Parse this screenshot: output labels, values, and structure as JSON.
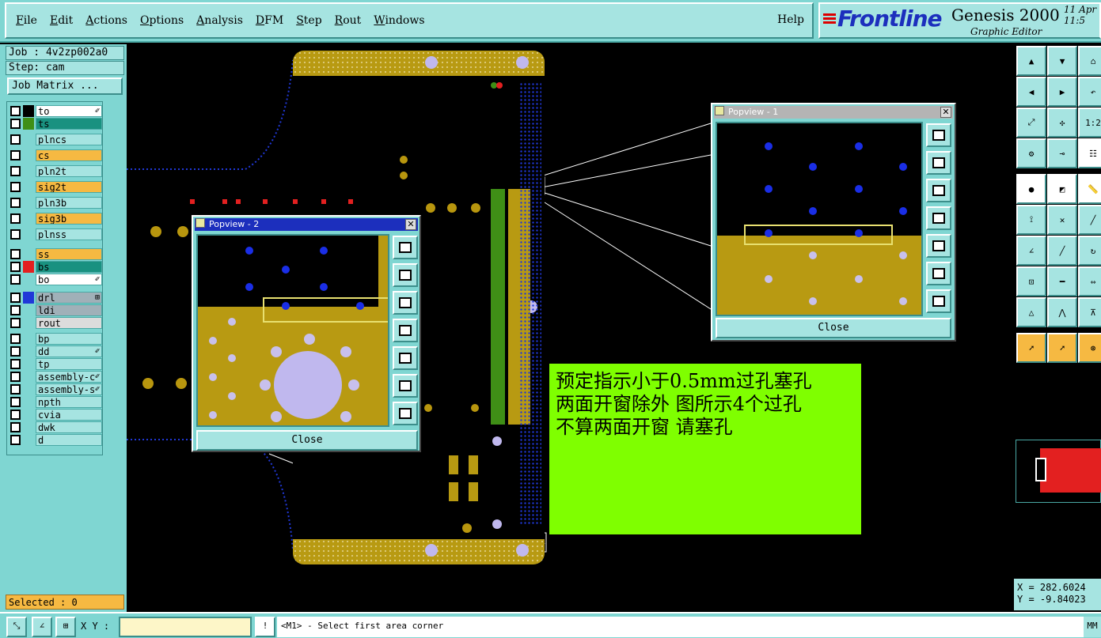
{
  "menu": [
    "File",
    "Edit",
    "Actions",
    "Options",
    "Analysis",
    "DFM",
    "Step",
    "Rout",
    "Windows"
  ],
  "help": "Help",
  "brand": {
    "logo": "Frontline",
    "product": "Genesis 2000",
    "subtitle": "Graphic Editor",
    "date_line1": "11 Apr",
    "date_line2": "11:5"
  },
  "job": {
    "job_label": "Job : 4v2zp002a0",
    "step_label": "Step: cam",
    "matrix_button": "Job Matrix ..."
  },
  "layers": [
    {
      "name": "to",
      "color": "#ffffff",
      "swatch": "#000000",
      "icon": "✐"
    },
    {
      "name": "ts",
      "color": "#199180",
      "swatch": "#3f8f16",
      "icon": ""
    },
    {
      "name": "plncs",
      "color": "#a6e4e1",
      "swatch": "#7fd6d2",
      "icon": ""
    },
    {
      "name": "cs",
      "color": "#f6b942",
      "swatch": "#7fd6d2",
      "icon": ""
    },
    {
      "name": "pln2t",
      "color": "#a6e4e1",
      "swatch": "#7fd6d2",
      "icon": ""
    },
    {
      "name": "sig2t",
      "color": "#f6b942",
      "swatch": "#7fd6d2",
      "icon": ""
    },
    {
      "name": "pln3b",
      "color": "#a6e4e1",
      "swatch": "#7fd6d2",
      "icon": ""
    },
    {
      "name": "sig3b",
      "color": "#f6b942",
      "swatch": "#7fd6d2",
      "icon": ""
    },
    {
      "name": "plnss",
      "color": "#a6e4e1",
      "swatch": "#7fd6d2",
      "icon": ""
    },
    {
      "name": "ss",
      "color": "#f6b942",
      "swatch": "#7fd6d2",
      "icon": ""
    },
    {
      "name": "bs",
      "color": "#199180",
      "swatch": "#e32020",
      "icon": ""
    },
    {
      "name": "bo",
      "color": "#ffffff",
      "swatch": "#7fd6d2",
      "icon": "✐"
    },
    {
      "name": "drl",
      "color": "#a0b0b8",
      "swatch": "#2038d8",
      "icon": "⊞"
    },
    {
      "name": "ldi",
      "color": "#a0b0b8",
      "swatch": "#7fd6d2",
      "icon": ""
    },
    {
      "name": "rout",
      "color": "#dcdcdc",
      "swatch": "#7fd6d2",
      "icon": ""
    },
    {
      "name": "bp",
      "color": "#a6e4e1",
      "swatch": "#7fd6d2",
      "icon": ""
    },
    {
      "name": "dd",
      "color": "#a6e4e1",
      "swatch": "#7fd6d2",
      "icon": "✐"
    },
    {
      "name": "tp",
      "color": "#a6e4e1",
      "swatch": "#7fd6d2",
      "icon": ""
    },
    {
      "name": "assembly-c",
      "color": "#a6e4e1",
      "swatch": "#7fd6d2",
      "icon": "✐"
    },
    {
      "name": "assembly-s",
      "color": "#a6e4e1",
      "swatch": "#7fd6d2",
      "icon": "✐"
    },
    {
      "name": "npth",
      "color": "#a6e4e1",
      "swatch": "#7fd6d2",
      "icon": ""
    },
    {
      "name": "cvia",
      "color": "#a6e4e1",
      "swatch": "#7fd6d2",
      "icon": ""
    },
    {
      "name": "dwk",
      "color": "#a6e4e1",
      "swatch": "#7fd6d2",
      "icon": ""
    },
    {
      "name": "d",
      "color": "#a6e4e1",
      "swatch": "#7fd6d2",
      "icon": ""
    }
  ],
  "selected": "Selected : 0",
  "popview1": {
    "title": "Popview - 1",
    "close": "Close"
  },
  "popview2": {
    "title": "Popview - 2",
    "close": "Close"
  },
  "note": {
    "line1": "预定指示小于0.5mm过孔塞孔",
    "line2": "两面开窗除外 图所示4个过孔",
    "line3": "不算两面开窗 请塞孔"
  },
  "coords": {
    "x": "X = 282.6024",
    "y": "Y = -9.84023"
  },
  "status": {
    "xy_label": "X Y :",
    "prompt": "<M1> - Select first area corner",
    "mm": "MM"
  },
  "tools": {
    "zoom_ratio": "1:2"
  }
}
